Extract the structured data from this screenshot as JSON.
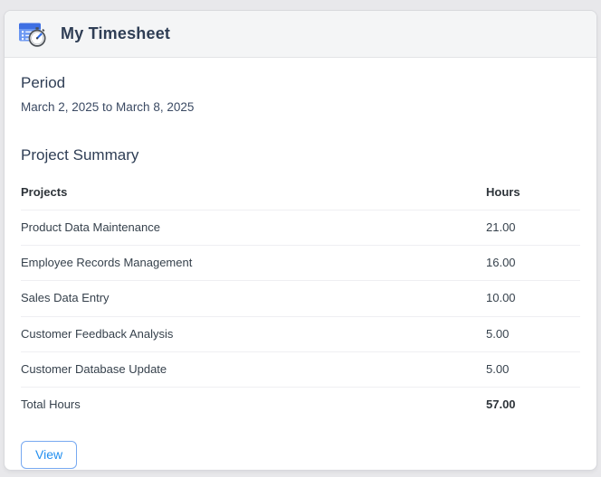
{
  "colors": {
    "accent_blue": "#2490ef",
    "header_band_bg": "#f4f5f6",
    "heading_navy": "#2f3e55",
    "table_text": "#36414c",
    "page_bg": "#e8e8eb",
    "icon_table_blue": "#4f7ded",
    "icon_table_dark_blue": "#3a66d9"
  },
  "card": {
    "header": {
      "title": "My Timesheet",
      "icon": "timesheet-clock-icon"
    },
    "period": {
      "heading": "Period",
      "range": "March 2, 2025 to March 8, 2025"
    },
    "summary": {
      "heading": "Project Summary",
      "table": {
        "columns": [
          "Projects",
          "Hours"
        ],
        "rows": [
          {
            "project": "Product Data Maintenance",
            "hours": "21.00"
          },
          {
            "project": "Employee Records Management",
            "hours": "16.00"
          },
          {
            "project": "Sales Data Entry",
            "hours": "10.00"
          },
          {
            "project": "Customer Feedback Analysis",
            "hours": "5.00"
          },
          {
            "project": "Customer Database Update",
            "hours": "5.00"
          }
        ],
        "total": {
          "label": "Total Hours",
          "hours": "57.00"
        }
      }
    },
    "actions": {
      "view_label": "View"
    }
  }
}
